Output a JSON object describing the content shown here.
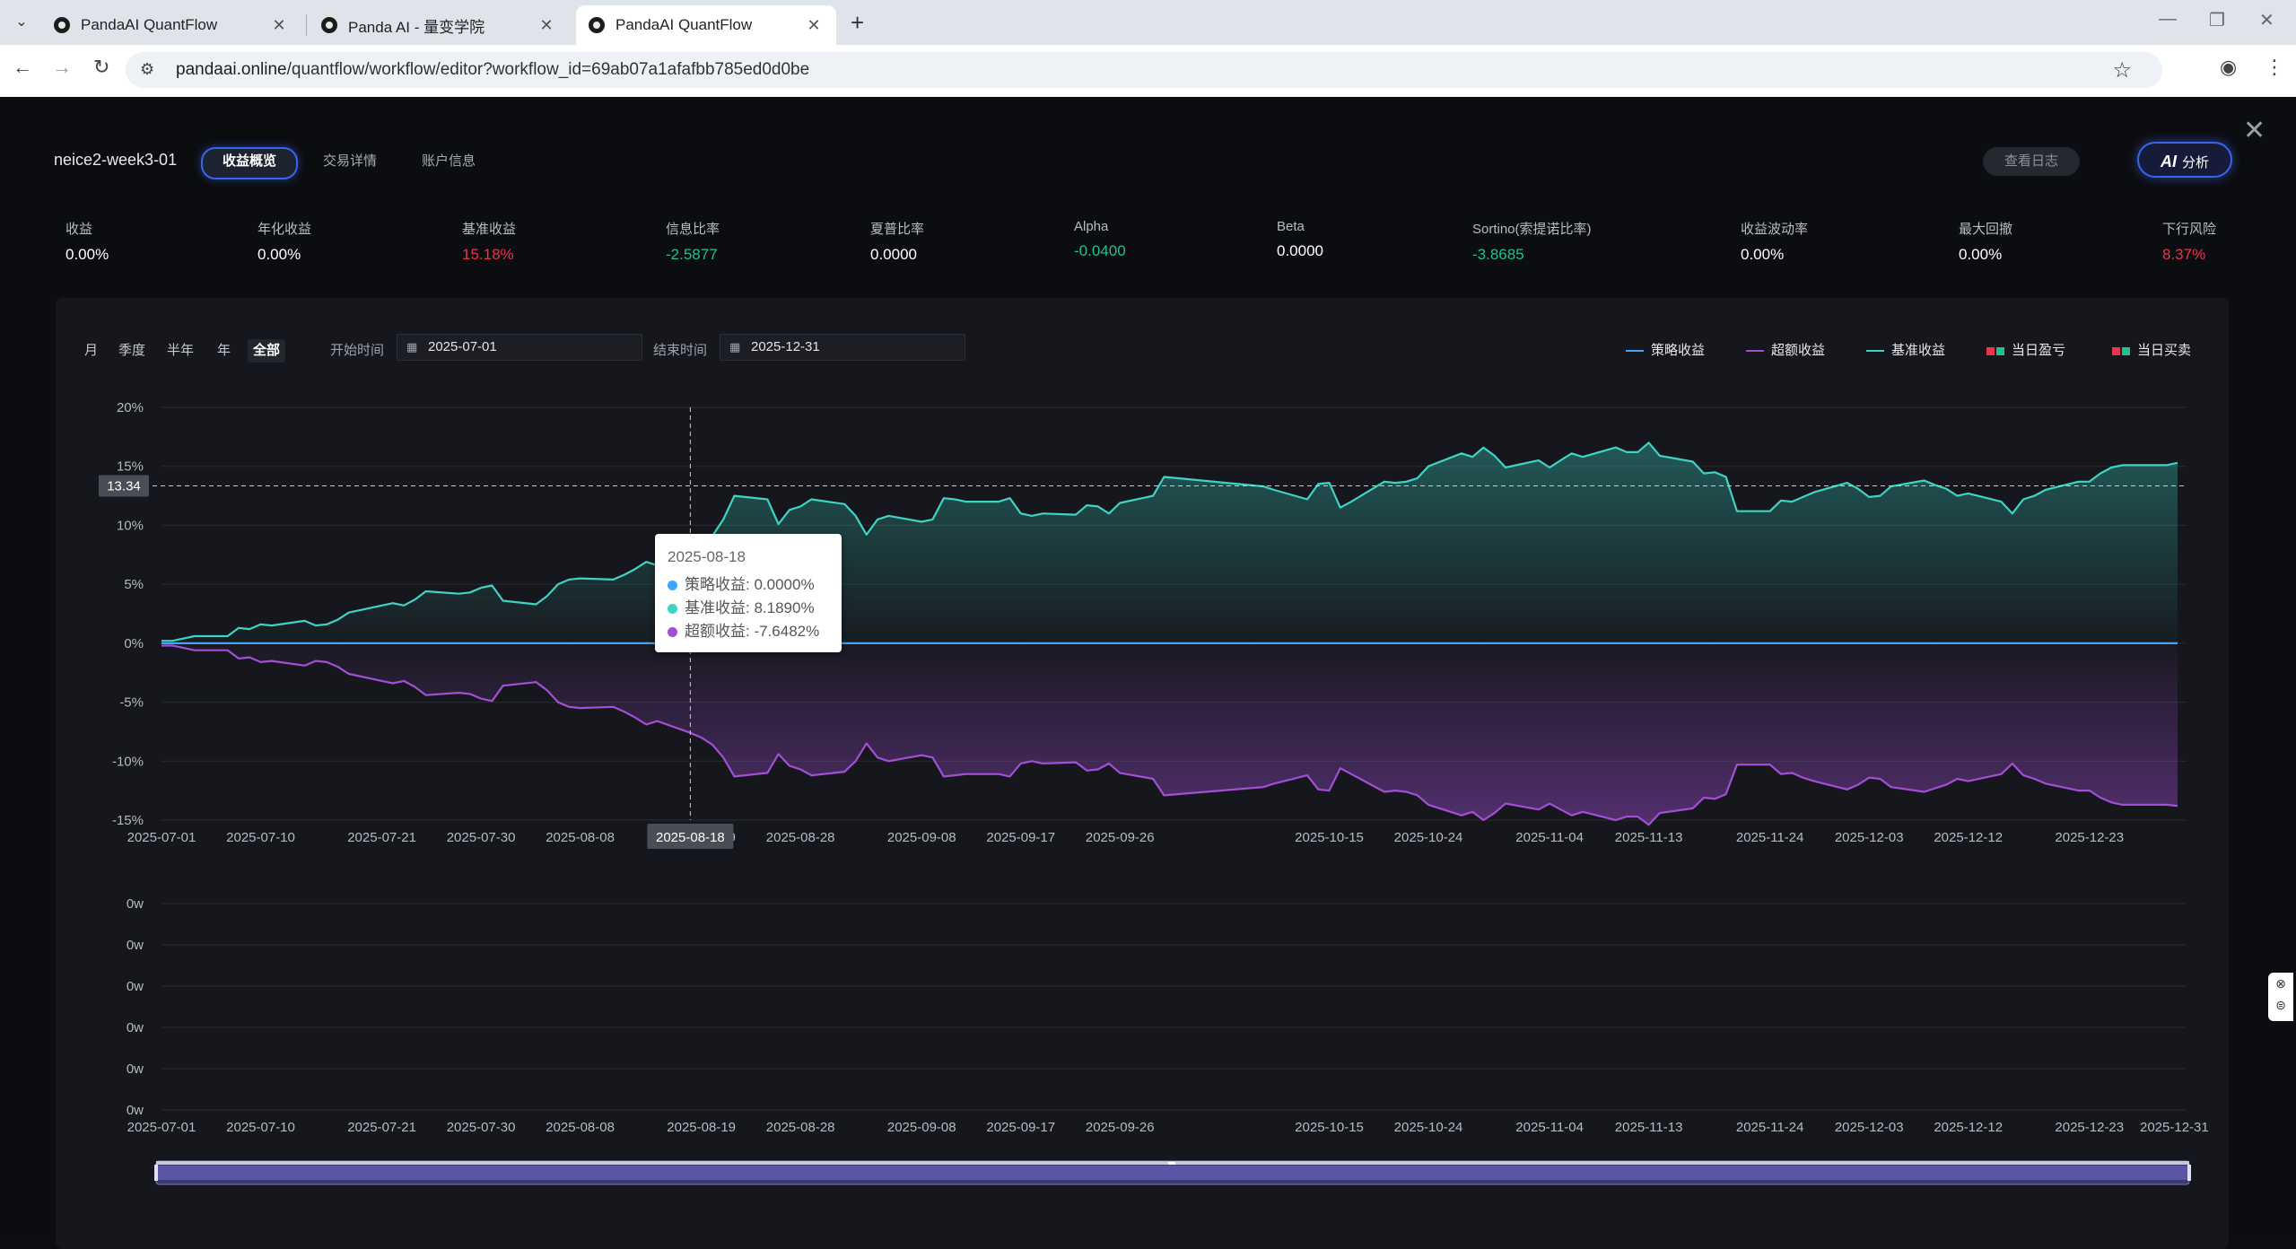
{
  "browser": {
    "tabs": [
      {
        "title": "PandaAI QuantFlow",
        "active": false
      },
      {
        "title": "Panda AI - 量变学院",
        "active": false
      },
      {
        "title": "PandaAI QuantFlow",
        "active": true
      }
    ],
    "url_host": "pandaai.online",
    "url_path": "/quantflow/workflow/editor?workflow_id=69ab07a1afafbb785ed0d0be"
  },
  "panel": {
    "title": "neice2-week3-01",
    "tabs": [
      "收益概览",
      "交易详情",
      "账户信息"
    ],
    "log_button": "查看日志",
    "ai_glyph": "AI",
    "ai_button": "分析"
  },
  "metrics": [
    {
      "label": "收益",
      "value": "0.00%",
      "tone": "neutral"
    },
    {
      "label": "年化收益",
      "value": "0.00%",
      "tone": "neutral"
    },
    {
      "label": "基准收益",
      "value": "15.18%",
      "tone": "red"
    },
    {
      "label": "信息比率",
      "value": "-2.5877",
      "tone": "green"
    },
    {
      "label": "夏普比率",
      "value": "0.0000",
      "tone": "neutral"
    },
    {
      "label": "Alpha",
      "value": "-0.0400",
      "tone": "green"
    },
    {
      "label": "Beta",
      "value": "0.0000",
      "tone": "neutral"
    },
    {
      "label": "Sortino(索提诺比率)",
      "value": "-3.8685",
      "tone": "green"
    },
    {
      "label": "收益波动率",
      "value": "0.00%",
      "tone": "neutral"
    },
    {
      "label": "最大回撤",
      "value": "0.00%",
      "tone": "neutral"
    },
    {
      "label": "下行风险",
      "value": "8.37%",
      "tone": "red"
    }
  ],
  "filters": {
    "periods": [
      "月",
      "季度",
      "半年",
      "年",
      "全部"
    ],
    "active_period": "全部",
    "start_label": "开始时间",
    "start_value": "2025-07-01",
    "end_label": "结束时间",
    "end_value": "2025-12-31"
  },
  "legend": [
    {
      "name": "策略收益",
      "kind": "line",
      "color": "#3ea6ff"
    },
    {
      "name": "超额收益",
      "kind": "line",
      "color": "#a24fd6"
    },
    {
      "name": "基准收益",
      "kind": "line",
      "color": "#3ed3c4"
    },
    {
      "name": "当日盈亏",
      "kind": "squares",
      "colors": [
        "#e8344f",
        "#22c08a"
      ]
    },
    {
      "name": "当日买卖",
      "kind": "squares",
      "colors": [
        "#e8344f",
        "#22c08a"
      ]
    }
  ],
  "crosshair": {
    "x_label": "2025-08-18",
    "y_label": "13.34"
  },
  "tooltip": {
    "date": "2025-08-18",
    "rows": [
      {
        "label": "策略收益: 0.0000%",
        "color": "#3ea6ff"
      },
      {
        "label": "基准收益: 8.1890%",
        "color": "#3ed3c4"
      },
      {
        "label": "超额收益: -7.6482%",
        "color": "#a24fd6"
      }
    ]
  },
  "chart_data": [
    {
      "type": "line",
      "ylim": [
        -15,
        20
      ],
      "yticks": [
        "20%",
        "15%",
        "10%",
        "5%",
        "0%",
        "-5%",
        "-10%",
        "-15%"
      ],
      "xticks": [
        "2025-07-01",
        "2025-07-10",
        "2025-07-21",
        "2025-07-30",
        "2025-08-08",
        "2025-08-19",
        "2025-08-28",
        "2025-09-08",
        "2025-09-17",
        "2025-09-26",
        "2025-10-15",
        "2025-10-24",
        "2025-11-04",
        "2025-11-13",
        "2025-11-24",
        "2025-12-03",
        "2025-12-12",
        "2025-12-23"
      ],
      "x": [
        "2025-07-01",
        "2025-07-02",
        "2025-07-03",
        "2025-07-04",
        "2025-07-07",
        "2025-07-08",
        "2025-07-09",
        "2025-07-10",
        "2025-07-11",
        "2025-07-14",
        "2025-07-15",
        "2025-07-16",
        "2025-07-17",
        "2025-07-18",
        "2025-07-21",
        "2025-07-22",
        "2025-07-23",
        "2025-07-24",
        "2025-07-25",
        "2025-07-28",
        "2025-07-29",
        "2025-07-30",
        "2025-07-31",
        "2025-08-01",
        "2025-08-04",
        "2025-08-05",
        "2025-08-06",
        "2025-08-07",
        "2025-08-08",
        "2025-08-11",
        "2025-08-12",
        "2025-08-13",
        "2025-08-14",
        "2025-08-15",
        "2025-08-18",
        "2025-08-19",
        "2025-08-20",
        "2025-08-21",
        "2025-08-22",
        "2025-08-25",
        "2025-08-26",
        "2025-08-27",
        "2025-08-28",
        "2025-08-29",
        "2025-09-01",
        "2025-09-02",
        "2025-09-03",
        "2025-09-04",
        "2025-09-05",
        "2025-09-08",
        "2025-09-09",
        "2025-09-10",
        "2025-09-11",
        "2025-09-12",
        "2025-09-15",
        "2025-09-16",
        "2025-09-17",
        "2025-09-18",
        "2025-09-19",
        "2025-09-22",
        "2025-09-23",
        "2025-09-24",
        "2025-09-25",
        "2025-09-26",
        "2025-09-29",
        "2025-09-30",
        "2025-10-09",
        "2025-10-10",
        "2025-10-13",
        "2025-10-14",
        "2025-10-15",
        "2025-10-16",
        "2025-10-17",
        "2025-10-20",
        "2025-10-21",
        "2025-10-22",
        "2025-10-23",
        "2025-10-24",
        "2025-10-27",
        "2025-10-28",
        "2025-10-29",
        "2025-10-30",
        "2025-10-31",
        "2025-11-03",
        "2025-11-04",
        "2025-11-05",
        "2025-11-06",
        "2025-11-07",
        "2025-11-10",
        "2025-11-11",
        "2025-11-12",
        "2025-11-13",
        "2025-11-14",
        "2025-11-17",
        "2025-11-18",
        "2025-11-19",
        "2025-11-20",
        "2025-11-21",
        "2025-11-24",
        "2025-11-25",
        "2025-11-26",
        "2025-11-27",
        "2025-11-28",
        "2025-12-01",
        "2025-12-02",
        "2025-12-03",
        "2025-12-04",
        "2025-12-05",
        "2025-12-08",
        "2025-12-09",
        "2025-12-10",
        "2025-12-11",
        "2025-12-12",
        "2025-12-15",
        "2025-12-16",
        "2025-12-17",
        "2025-12-18",
        "2025-12-19",
        "2025-12-22",
        "2025-12-23",
        "2025-12-24",
        "2025-12-25",
        "2025-12-26",
        "2025-12-29",
        "2025-12-30",
        "2025-12-31"
      ],
      "series": [
        {
          "name": "策略收益",
          "color": "#3ea6ff",
          "values": [
            0.0,
            0.0,
            0.0,
            0.0,
            0.0,
            0.0,
            0.0,
            0.0,
            0.0,
            0.0,
            0.0,
            0.0,
            0.0,
            0.0,
            0.0,
            0.0,
            0.0,
            0.0,
            0.0,
            0.0,
            0.0,
            0.0,
            0.0,
            0.0,
            0.0,
            0.0,
            0.0,
            0.0,
            0.0,
            0.0,
            0.0,
            0.0,
            0.0,
            0.0,
            0.0,
            0.0,
            0.0,
            0.0,
            0.0,
            0.0,
            0.0,
            0.0,
            0.0,
            0.0,
            0.0,
            0.0,
            0.0,
            0.0,
            0.0,
            0.0,
            0.0,
            0.0,
            0.0,
            0.0,
            0.0,
            0.0,
            0.0,
            0.0,
            0.0,
            0.0,
            0.0,
            0.0,
            0.0,
            0.0,
            0.0,
            0.0,
            0.0,
            0.0,
            0.0,
            0.0,
            0.0,
            0.0,
            0.0,
            0.0,
            0.0,
            0.0,
            0.0,
            0.0,
            0.0,
            0.0,
            0.0,
            0.0,
            0.0,
            0.0,
            0.0,
            0.0,
            0.0,
            0.0,
            0.0,
            0.0,
            0.0,
            0.0,
            0.0,
            0.0,
            0.0,
            0.0,
            0.0,
            0.0,
            0.0,
            0.0,
            0.0,
            0.0,
            0.0,
            0.0,
            0.0,
            0.0,
            0.0,
            0.0,
            0.0,
            0.0,
            0.0,
            0.0,
            0.0,
            0.0,
            0.0,
            0.0,
            0.0,
            0.0,
            0.0,
            0.0,
            0.0,
            0.0,
            0.0,
            0.0,
            0.0,
            0.0
          ]
        },
        {
          "name": "基准收益",
          "color": "#3ed3c4",
          "values": [
            0.2,
            0.2,
            0.4,
            0.6,
            0.6,
            1.3,
            1.2,
            1.6,
            1.5,
            1.9,
            1.5,
            1.6,
            2.0,
            2.6,
            3.2,
            3.4,
            3.2,
            3.7,
            4.4,
            4.2,
            4.3,
            4.7,
            4.9,
            3.6,
            3.3,
            4.0,
            5.0,
            5.4,
            5.5,
            5.4,
            5.8,
            6.3,
            6.9,
            6.6,
            8.2,
            8.7,
            9.1,
            10.5,
            12.5,
            12.2,
            10.1,
            11.3,
            11.6,
            12.2,
            11.8,
            10.8,
            9.2,
            10.5,
            10.8,
            10.3,
            10.5,
            12.3,
            12.2,
            12.0,
            12.0,
            12.3,
            11.0,
            10.8,
            11.0,
            10.9,
            11.7,
            11.6,
            11.0,
            11.9,
            12.5,
            14.1,
            13.3,
            13.0,
            12.2,
            13.5,
            13.6,
            11.5,
            12.0,
            13.7,
            13.6,
            13.7,
            14.0,
            15.0,
            16.1,
            15.8,
            16.6,
            15.9,
            14.9,
            15.5,
            14.9,
            15.5,
            16.1,
            15.8,
            16.6,
            16.2,
            16.2,
            17.0,
            15.9,
            15.4,
            14.4,
            14.5,
            14.1,
            11.2,
            11.2,
            12.1,
            12.0,
            12.4,
            12.8,
            13.6,
            13.1,
            12.4,
            12.5,
            13.3,
            13.8,
            13.4,
            13.1,
            12.5,
            12.7,
            12.0,
            11.0,
            12.2,
            12.5,
            13.0,
            13.7,
            13.7,
            14.4,
            14.9,
            15.1,
            15.1,
            15.1,
            15.3
          ]
        },
        {
          "name": "超额收益",
          "color": "#a24fd6",
          "values": [
            -0.2,
            -0.2,
            -0.4,
            -0.6,
            -0.6,
            -1.3,
            -1.2,
            -1.6,
            -1.5,
            -1.9,
            -1.5,
            -1.6,
            -2.0,
            -2.6,
            -3.2,
            -3.4,
            -3.2,
            -3.7,
            -4.4,
            -4.2,
            -4.3,
            -4.7,
            -4.9,
            -3.6,
            -3.3,
            -4.0,
            -5.0,
            -5.4,
            -5.5,
            -5.4,
            -5.8,
            -6.3,
            -6.9,
            -6.6,
            -7.6,
            -8.0,
            -8.6,
            -9.7,
            -11.3,
            -11.0,
            -9.4,
            -10.4,
            -10.7,
            -11.2,
            -10.9,
            -10.0,
            -8.5,
            -9.7,
            -10.0,
            -9.5,
            -9.7,
            -11.3,
            -11.2,
            -11.1,
            -11.1,
            -11.3,
            -10.2,
            -10.0,
            -10.2,
            -10.1,
            -10.8,
            -10.7,
            -10.2,
            -11.0,
            -11.5,
            -12.9,
            -12.2,
            -11.9,
            -11.2,
            -12.4,
            -12.5,
            -10.6,
            -11.1,
            -12.6,
            -12.5,
            -12.6,
            -12.9,
            -13.7,
            -14.6,
            -14.3,
            -15.0,
            -14.4,
            -13.6,
            -14.1,
            -13.6,
            -14.1,
            -14.6,
            -14.3,
            -15.0,
            -14.7,
            -14.7,
            -15.4,
            -14.4,
            -14.0,
            -13.1,
            -13.2,
            -12.8,
            -10.3,
            -10.3,
            -11.1,
            -11.0,
            -11.4,
            -11.7,
            -12.4,
            -12.0,
            -11.4,
            -11.5,
            -12.2,
            -12.6,
            -12.3,
            -12.0,
            -11.5,
            -11.7,
            -11.1,
            -10.2,
            -11.2,
            -11.5,
            -11.9,
            -12.5,
            -12.5,
            -13.1,
            -13.5,
            -13.7,
            -13.7,
            -13.7,
            -13.8
          ]
        }
      ]
    },
    {
      "type": "bar",
      "yticks": [
        "0w",
        "0w",
        "0w",
        "0w",
        "0w",
        "0w"
      ],
      "xticks": [
        "2025-07-01",
        "2025-07-10",
        "2025-07-21",
        "2025-07-30",
        "2025-08-08",
        "2025-08-19",
        "2025-08-28",
        "2025-09-08",
        "2025-09-17",
        "2025-09-26",
        "2025-10-15",
        "2025-10-24",
        "2025-11-04",
        "2025-11-13",
        "2025-11-24",
        "2025-12-03",
        "2025-12-12",
        "2025-12-23",
        "2025-12-31"
      ]
    }
  ]
}
